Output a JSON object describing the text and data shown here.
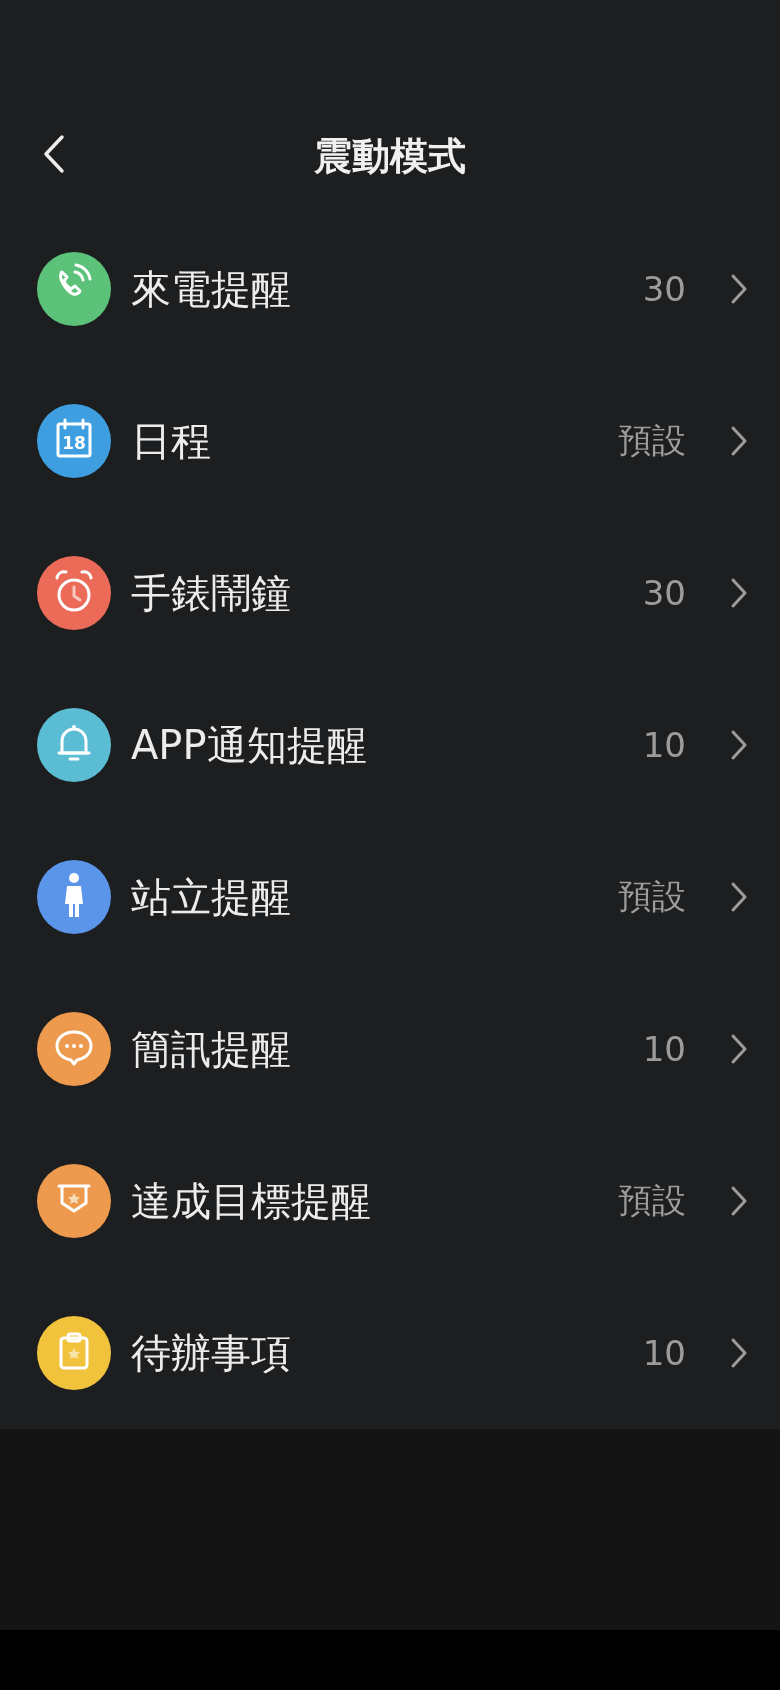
{
  "header": {
    "title": "震動模式"
  },
  "items": [
    {
      "kind": "phone",
      "color": "#5cc27a",
      "label": "來電提醒",
      "value": "30"
    },
    {
      "kind": "calendar",
      "color": "#3f9ee0",
      "icon_text": "18",
      "label": "日程",
      "value": "預設"
    },
    {
      "kind": "alarm",
      "color": "#eb6a58",
      "label": "手錶鬧鐘",
      "value": "30"
    },
    {
      "kind": "bell",
      "color": "#5bbdd3",
      "label": "APP通知提醒",
      "value": "10"
    },
    {
      "kind": "person",
      "color": "#5a95ea",
      "label": "站立提醒",
      "value": "預設"
    },
    {
      "kind": "message",
      "color": "#ee9a4e",
      "label": "簡訊提醒",
      "value": "10"
    },
    {
      "kind": "badge",
      "color": "#ee9a4e",
      "label": "達成目標提醒",
      "value": "預設"
    },
    {
      "kind": "clipboard",
      "color": "#f1c33c",
      "label": "待辦事項",
      "value": "10"
    }
  ]
}
